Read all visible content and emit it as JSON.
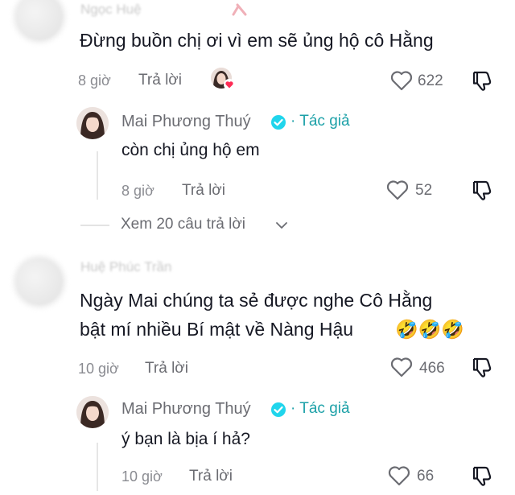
{
  "comments": [
    {
      "faded_name": "Ngọc Huệ",
      "text": "Đừng buồn chị ơi vì em sẽ ủng hộ cô Hằng",
      "time": "8 giờ",
      "reply_label": "Trả lời",
      "likes": "622",
      "reply": {
        "author": "Mai Phương Thuý",
        "author_tag": "· Tác giả",
        "text": "còn chị ủng hộ em",
        "time": "8 giờ",
        "reply_label": "Trả lời",
        "likes": "52"
      },
      "view_more": "Xem 20 câu trả lời"
    },
    {
      "faded_name": "Huệ Phúc Trần",
      "text_line1": "Ngày Mai chúng ta sẻ được nghe Cô Hằng",
      "text_line2": "bật mí nhiều Bí mật về Nàng Hậu",
      "emoji": "🤣🤣🤣",
      "time": "10 giờ",
      "reply_label": "Trả lời",
      "likes": "466",
      "reply": {
        "author": "Mai Phương Thuý",
        "author_tag": "· Tác giả",
        "text": "ý bạn là bịa í hả?",
        "time": "10 giờ",
        "reply_label": "Trả lời",
        "likes": "66"
      }
    }
  ],
  "colors": {
    "accent": "#1da1a8",
    "muted": "#8a8b91",
    "text": "#161823",
    "heart_badge": "#fe2c55"
  }
}
